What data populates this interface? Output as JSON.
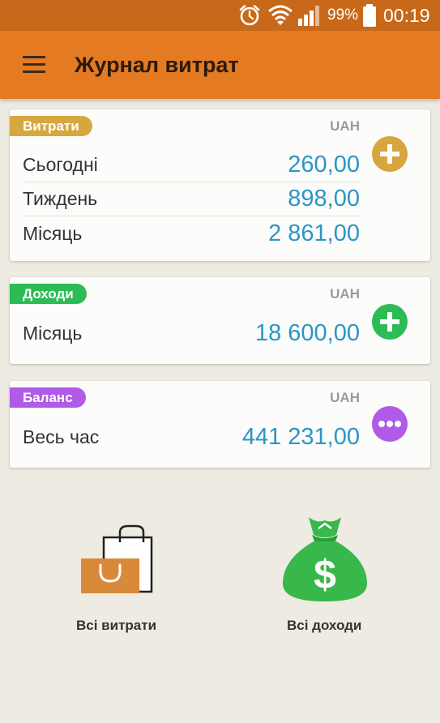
{
  "status_bar": {
    "battery_percent": "99%",
    "time": "00:19",
    "icons": [
      "alarm-icon",
      "wifi-icon",
      "signal-icon",
      "battery-icon"
    ]
  },
  "app_bar": {
    "title": "Журнал витрат",
    "menu_icon": "hamburger-menu-icon"
  },
  "expenses_card": {
    "badge": "Витрати",
    "badge_color": "#d6a63f",
    "currency": "UAH",
    "rows": [
      {
        "label": "Сьогодні",
        "value": "260,00"
      },
      {
        "label": "Тиждень",
        "value": "898,00"
      },
      {
        "label": "Місяць",
        "value": "2 861,00"
      }
    ],
    "action_icon": "plus-icon",
    "action_color": "#d6a63f"
  },
  "income_card": {
    "badge": "Доходи",
    "badge_color": "#2dbb55",
    "currency": "UAH",
    "rows": [
      {
        "label": "Місяць",
        "value": "18 600,00"
      }
    ],
    "action_icon": "plus-icon",
    "action_color": "#2dbb55"
  },
  "balance_card": {
    "badge": "Баланс",
    "badge_color": "#b05be8",
    "currency": "UAH",
    "rows": [
      {
        "label": "Весь час",
        "value": "441 231,00"
      }
    ],
    "action_icon": "more-icon",
    "action_color": "#b05be8"
  },
  "shortcuts": {
    "all_expenses": {
      "label": "Всі витрати",
      "icon": "shopping-bag-icon"
    },
    "all_income": {
      "label": "Всі доходи",
      "icon": "money-bag-icon"
    }
  },
  "colors": {
    "status_bar": "#c8681a",
    "app_bar": "#e47b22",
    "value_text": "#2a95c8",
    "background": "#eeebe2"
  }
}
